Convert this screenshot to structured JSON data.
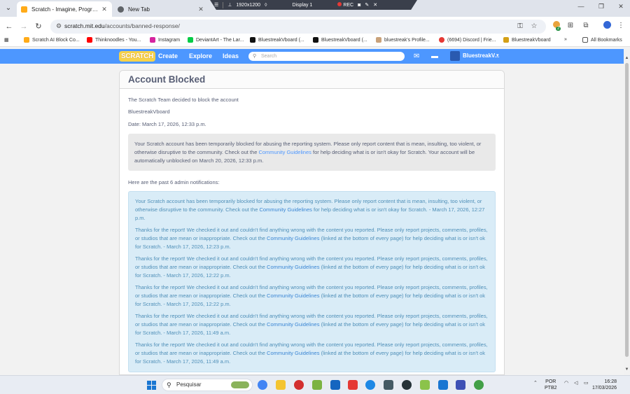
{
  "browser": {
    "tabs": [
      {
        "title": "Scratch - Imagine, Program, Sh",
        "active": true,
        "favicon_color": "#ffab19"
      },
      {
        "title": "New Tab",
        "active": false,
        "favicon_color": "#5f6368"
      }
    ],
    "recorder": {
      "resolution": "1920x1200",
      "display": "Display 1",
      "rec_label": "REC"
    },
    "url_host": "scratch.mit.edu",
    "url_path": "/accounts/banned-response/",
    "bookmarks": [
      "Scratch AI Block Co...",
      "Thinknoodles - You...",
      "Instagram",
      "DeviantArt - The Lar...",
      "BluestreakVboard (...",
      "BluestreakVboard (...",
      "bluestreak's Profile...",
      "(6694) Discord | Frie...",
      "BluestreakVboard"
    ],
    "all_bookmarks": "All Bookmarks",
    "extension_badge": "2"
  },
  "scratch_nav": {
    "logo": "SCRATCH",
    "links": [
      "Create",
      "Explore",
      "Ideas"
    ],
    "search_placeholder": "Search",
    "username": "BluestreakV..."
  },
  "page": {
    "title": "Account Blocked",
    "intro": "The Scratch Team decided to block the account",
    "account": "BluestreakVboard",
    "date": "Date: March 17, 2026, 12:33 p.m.",
    "notice": {
      "before": "Your Scratch account has been temporarily blocked for abusing the reporting system. Please only report content that is mean, insulting, too violent, or otherwise disruptive to the community. Check out the ",
      "link": "Community Guidelines",
      "after": " for help deciding what is or isn't okay for Scratch. Your account will be automatically unblocked on March 20, 2026, 12:33 p.m."
    },
    "past_heading": "Here are the past 6 admin notifications:",
    "notifications": [
      {
        "before": "Your Scratch account has been temporarily blocked for abusing the reporting system. Please only report content that is mean, insulting, too violent, or otherwise disruptive to the community. Check out the ",
        "link": "Community Guidelines",
        "after": " for help deciding what is or isn't okay for Scratch. - March 17, 2026, 12:27 p.m."
      },
      {
        "before": "Thanks for the report! We checked it out and couldn't find anything wrong with the content you reported. Please only report projects, comments, profiles, or studios that are mean or inappropriate. Check out the ",
        "link": "Community Guidelines",
        "after": " (linked at the bottom of every page) for help deciding what is or isn't ok for Scratch. - March 17, 2026, 12:23 p.m."
      },
      {
        "before": "Thanks for the report! We checked it out and couldn't find anything wrong with the content you reported. Please only report projects, comments, profiles, or studios that are mean or inappropriate. Check out the ",
        "link": "Community Guidelines",
        "after": " (linked at the bottom of every page) for help deciding what is or isn't ok for Scratch. - March 17, 2026, 12:22 p.m."
      },
      {
        "before": "Thanks for the report! We checked it out and couldn't find anything wrong with the content you reported. Please only report projects, comments, profiles, or studios that are mean or inappropriate. Check out the ",
        "link": "Community Guidelines",
        "after": " (linked at the bottom of every page) for help deciding what is or isn't ok for Scratch. - March 17, 2026, 12:22 p.m."
      },
      {
        "before": "Thanks for the report! We checked it out and couldn't find anything wrong with the content you reported. Please only report projects, comments, profiles, or studios that are mean or inappropriate. Check out the ",
        "link": "Community Guidelines",
        "after": " (linked at the bottom of every page) for help deciding what is or isn't ok for Scratch. - March 17, 2026, 11:49 a.m."
      },
      {
        "before": "Thanks for the report! We checked it out and couldn't find anything wrong with the content you reported. Please only report projects, comments, profiles, or studios that are mean or inappropriate. Check out the ",
        "link": "Community Guidelines",
        "after": " (linked at the bottom of every page) for help deciding what is or isn't ok for Scratch. - March 17, 2026, 11:49 a.m."
      }
    ]
  },
  "taskbar": {
    "search_label": "Pesquisar",
    "lang_line1": "POR",
    "lang_line2": "PTB2",
    "time": "16:28",
    "date": "17/03/2026"
  },
  "colors": {
    "scratch_blue": "#4d97ff",
    "link_blue": "#4d97ff",
    "notif_bg": "#d9ecf7",
    "notice_bg": "#e9e9e9",
    "text_gray": "#575e75"
  }
}
